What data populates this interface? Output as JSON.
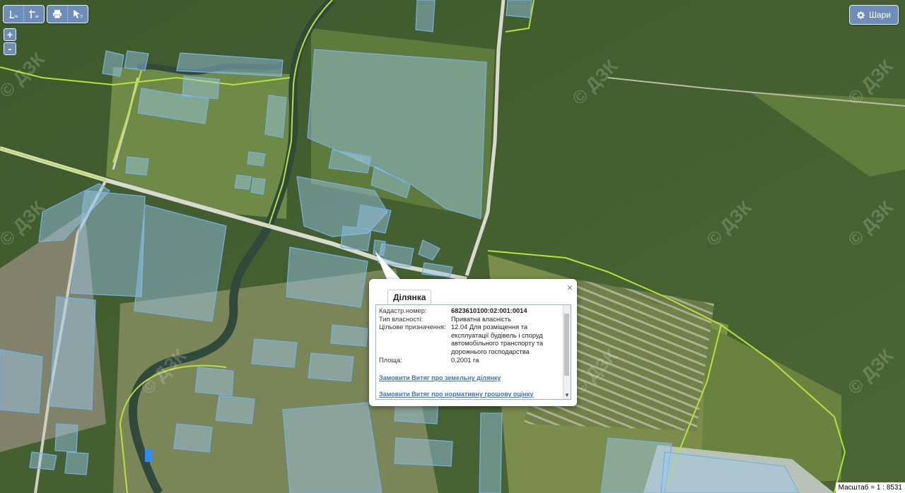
{
  "toolbar": {
    "ruler_tools": [
      {
        "name": "measure-distance-button",
        "label": "|"
      },
      {
        "name": "measure-area-button",
        "label": "⊢"
      }
    ],
    "print_tools": [
      {
        "name": "print-button",
        "icon": "printer-icon"
      },
      {
        "name": "identify-button",
        "icon": "cursor-question-icon"
      }
    ],
    "zoom_in": "+",
    "zoom_out": "-"
  },
  "layers_button": {
    "label": "Шари",
    "icon": "gear-icon"
  },
  "popup": {
    "tab_label": "Ділянка",
    "close_label": "×",
    "fields": [
      {
        "label": "Кадастр.номер:",
        "value": "6823610100:02:001:0014"
      },
      {
        "label": "Тип власності:",
        "value": "Приватна власність"
      },
      {
        "label": "Цільове призначення:",
        "value": "12.04 Для розміщення та експлуатації будівель і споруд автомобільного транспорту та дорожнього господарства"
      },
      {
        "label": "Площа:",
        "value": "0.2001 га"
      }
    ],
    "links": [
      "Замовити Витяг про земельну ділянку",
      "Замовити Витяг про нормативну грошову оцінку"
    ]
  },
  "scale_text": "Масштаб = 1 : 8531",
  "watermark": "© ДЗК",
  "colors": {
    "parcel_fill": "#9ec9ee",
    "parcel_stroke": "#6fb2e8",
    "boundary": "#b6e23a",
    "river": "#3d5a4a",
    "road": "#d9d9d0",
    "ui_blue": "#6f8db9"
  }
}
